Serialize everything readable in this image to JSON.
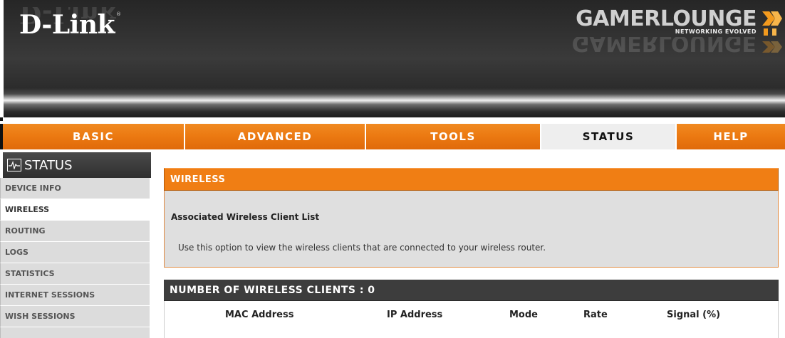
{
  "header": {
    "brand": "D-Link",
    "brand_tm": "®",
    "product_logo": "GAMERLOUNGE",
    "product_tagline": "NETWORKING EVOLVED"
  },
  "topnav": [
    {
      "label": "BASIC",
      "active": false
    },
    {
      "label": "ADVANCED",
      "active": false
    },
    {
      "label": "TOOLS",
      "active": false
    },
    {
      "label": "STATUS",
      "active": true
    },
    {
      "label": "HELP",
      "active": false
    }
  ],
  "sidebar": {
    "title": "STATUS",
    "icon": "pulse-monitor-icon",
    "items": [
      {
        "label": "DEVICE INFO",
        "active": false
      },
      {
        "label": "WIRELESS",
        "active": true
      },
      {
        "label": "ROUTING",
        "active": false
      },
      {
        "label": "LOGS",
        "active": false
      },
      {
        "label": "STATISTICS",
        "active": false
      },
      {
        "label": "INTERNET SESSIONS",
        "active": false
      },
      {
        "label": "WISH SESSIONS",
        "active": false
      }
    ]
  },
  "main": {
    "section_title": "WIRELESS",
    "subtitle": "Associated Wireless Client List",
    "description": "Use this option to view the wireless clients that are connected to your wireless router.",
    "clients_heading": "NUMBER OF WIRELESS CLIENTS : 0",
    "columns": [
      "MAC Address",
      "IP Address",
      "Mode",
      "Rate",
      "Signal (%)"
    ]
  },
  "colors": {
    "nav_orange": "#f07e14",
    "nav_active_bg": "#eeeeee",
    "header_dark": "#2c2c2c",
    "panel_gray": "#dfdfdf",
    "sidebar_gray": "#dcdcdc",
    "clients_bar": "#3d3d3d"
  }
}
